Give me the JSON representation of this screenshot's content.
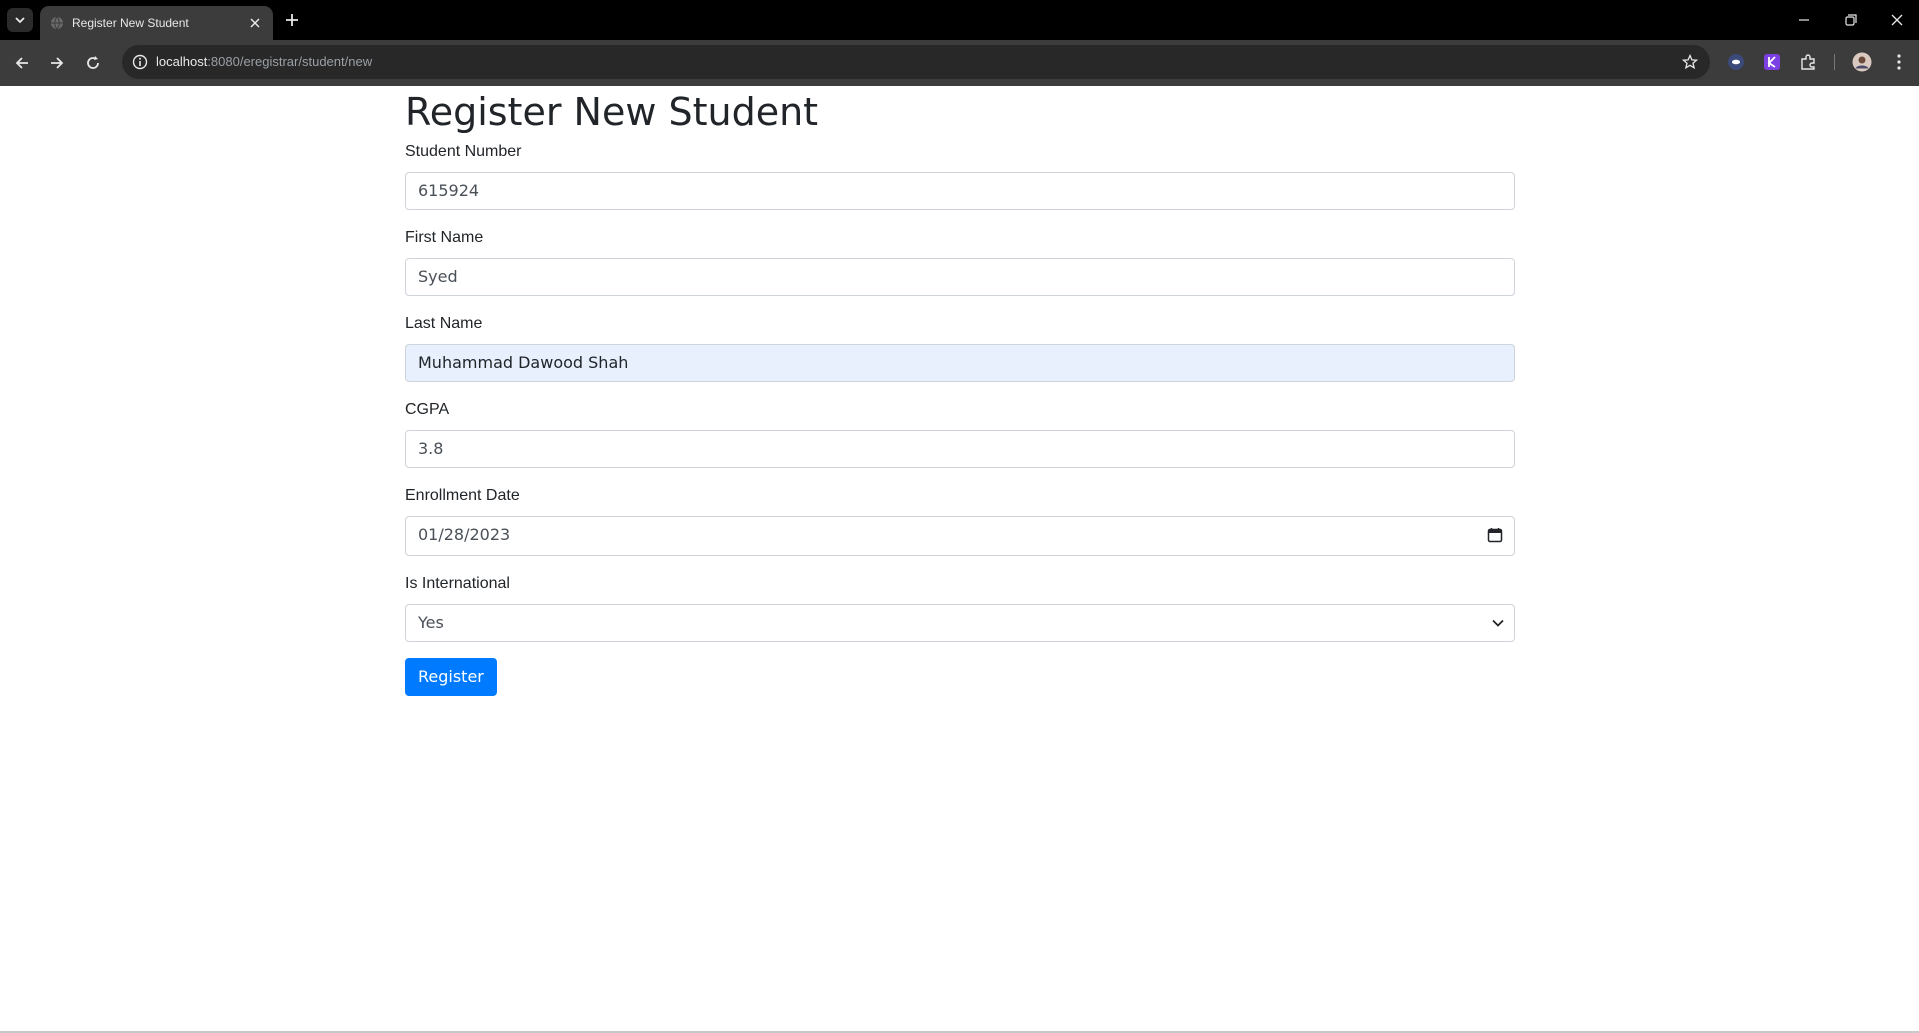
{
  "browser": {
    "tab_title": "Register New Student",
    "url_host": "localhost",
    "url_path": ":8080/eregistrar/student/new"
  },
  "form": {
    "heading": "Register New Student",
    "fields": {
      "student_number": {
        "label": "Student Number",
        "value": "615924"
      },
      "first_name": {
        "label": "First Name",
        "value": "Syed"
      },
      "last_name": {
        "label": "Last Name",
        "value": "Muhammad Dawood Shah"
      },
      "cgpa": {
        "label": "CGPA",
        "value": "3.8"
      },
      "enrollment_date": {
        "label": "Enrollment Date",
        "value": "01/28/2023"
      },
      "is_international": {
        "label": "Is International",
        "value": "Yes"
      }
    },
    "submit_label": "Register"
  },
  "colors": {
    "primary": "#007bff",
    "autofill_bg": "#e8f0fe",
    "text": "#212529",
    "border": "#ced4da"
  },
  "icons": [
    "tab-search-icon",
    "globe-icon",
    "close-icon",
    "plus-icon",
    "minimize-icon",
    "restore-icon",
    "back-icon",
    "forward-icon",
    "reload-icon",
    "info-icon",
    "star-icon",
    "extension-icon",
    "profile-icon",
    "menu-icon",
    "calendar-icon",
    "chevron-down-icon"
  ]
}
